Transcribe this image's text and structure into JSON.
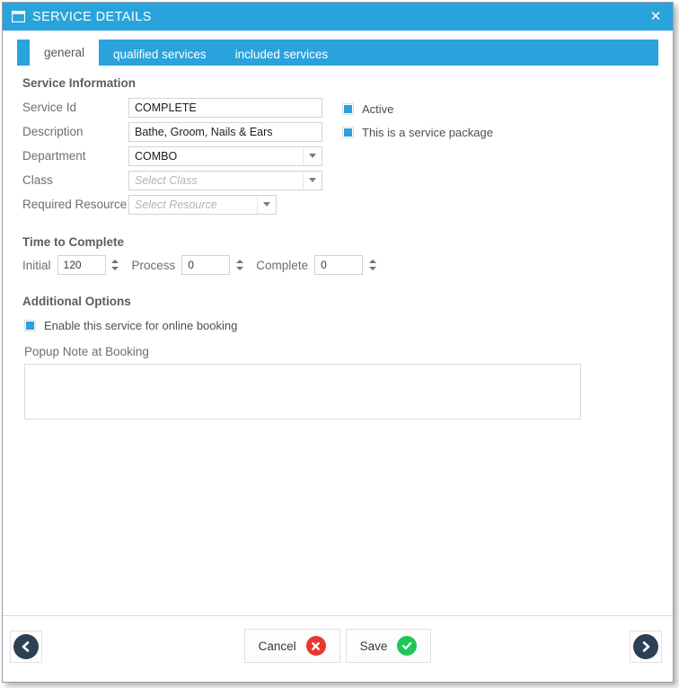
{
  "window": {
    "title": "SERVICE DETAILS",
    "title_icon": "window-icon",
    "close_label": "✕",
    "accent_color": "#29a3dc",
    "titlebar_text_color": "#ffffff"
  },
  "tabs": [
    {
      "label": "general",
      "active": true
    },
    {
      "label": "qualified services",
      "active": false
    },
    {
      "label": "included services",
      "active": false
    }
  ],
  "service_information": {
    "heading": "Service Information",
    "fields": [
      {
        "label": "Service Id",
        "value": "COMPLETE",
        "placeholder": "",
        "type": "text"
      },
      {
        "label": "Description",
        "value": "Bathe, Groom, Nails & Ears",
        "placeholder": "",
        "type": "text"
      },
      {
        "label": "Department",
        "value": "COMBO",
        "placeholder": "",
        "type": "combo"
      },
      {
        "label": "Class",
        "value": "",
        "placeholder": "Select Class",
        "type": "combo"
      },
      {
        "label": "Required Resource",
        "value": "",
        "placeholder": "Select Resource",
        "type": "combo"
      }
    ],
    "checkboxes": [
      {
        "label": "Active",
        "checked": true
      },
      {
        "label": "This is a service package",
        "checked": true
      }
    ]
  },
  "time_to_complete": {
    "heading": "Time to Complete",
    "steppers": [
      {
        "label": "Initial",
        "value": "120"
      },
      {
        "label": "Process",
        "value": "0"
      },
      {
        "label": "Complete",
        "value": "0"
      }
    ]
  },
  "additional_options": {
    "heading": "Additional Options",
    "online_booking": {
      "label": "Enable this service for online booking",
      "checked": true
    },
    "note_label": "Popup Note at Booking",
    "note_value": "",
    "note_placeholder": ""
  },
  "footer": {
    "prev_icon": "chevron-left-icon",
    "next_icon": "chevron-right-icon",
    "cancel": {
      "label": "Cancel",
      "icon": "x-circle-icon",
      "color": "#e8372f"
    },
    "save": {
      "label": "Save",
      "icon": "check-circle-icon",
      "color": "#20c65a"
    }
  }
}
